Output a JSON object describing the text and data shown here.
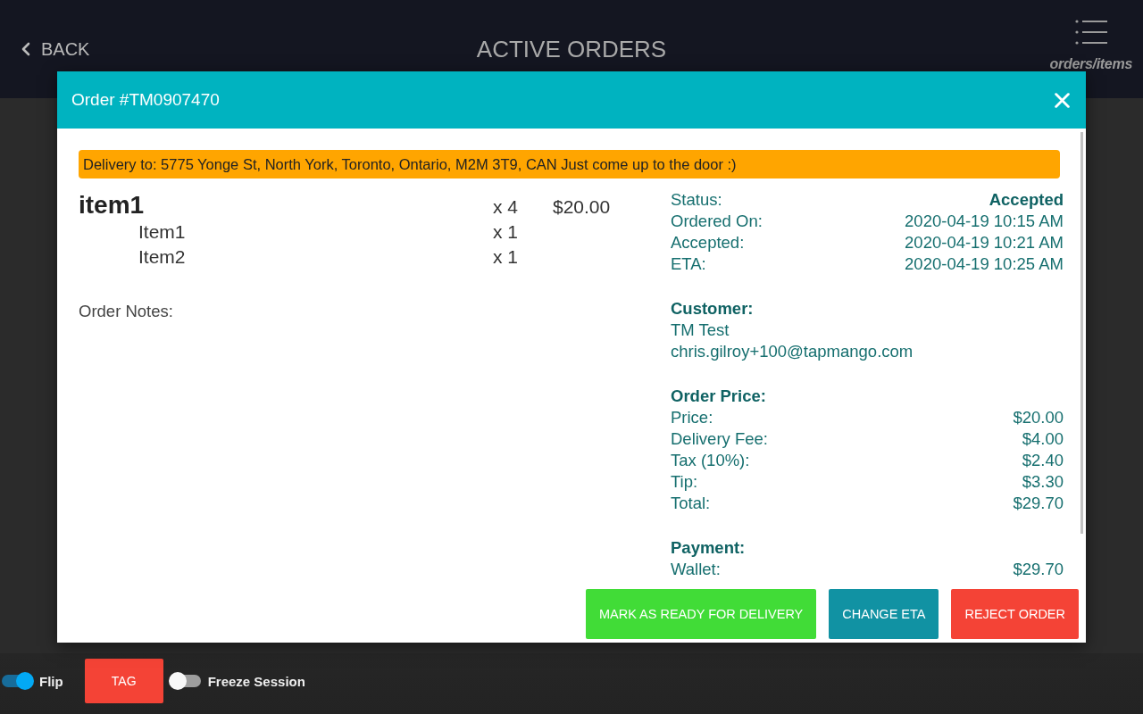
{
  "top_bar": {
    "back_label": "BACK",
    "title": "ACTIVE ORDERS",
    "menu_label": "orders/items"
  },
  "modal": {
    "title": "Order #TM0907470",
    "delivery_banner": "Delivery to: 5775 Yonge St, North York, Toronto, Ontario, M2M 3T9, CAN Just come up to the door :)",
    "items": [
      {
        "name": "item1",
        "quantity": "x 4",
        "price": "$20.00",
        "children": [
          {
            "name": "Item1",
            "quantity": "x 1"
          },
          {
            "name": "Item2",
            "quantity": "x 1"
          }
        ]
      }
    ],
    "notes_label": "Order Notes:",
    "info_sections": [
      {
        "rows": [
          {
            "label": "Status:",
            "value": "Accepted",
            "bold": true
          },
          {
            "label": "Ordered On:",
            "value": "2020-04-19 10:15 AM",
            "bold": false
          },
          {
            "label": "Accepted:",
            "value": "2020-04-19 10:21 AM",
            "bold": false
          },
          {
            "label": "ETA:",
            "value": "2020-04-19 10:25 AM",
            "bold": false
          }
        ]
      },
      {
        "heading": "Customer:",
        "lines": [
          "TM Test",
          "chris.gilroy+100@tapmango.com"
        ]
      },
      {
        "heading": "Order Price:",
        "rows": [
          {
            "label": "Price:",
            "value": "$20.00",
            "bold": false
          },
          {
            "label": "Delivery Fee:",
            "value": "$4.00",
            "bold": false
          },
          {
            "label": "Tax (10%):",
            "value": "$2.40",
            "bold": false
          },
          {
            "label": "Tip:",
            "value": "$3.30",
            "bold": false
          },
          {
            "label": "Total:",
            "value": "$29.70",
            "bold": false
          }
        ]
      },
      {
        "heading": "Payment:",
        "rows": [
          {
            "label": "Wallet:",
            "value": "$29.70",
            "bold": false
          }
        ]
      }
    ],
    "buttons": [
      {
        "label": "MARK AS READY FOR DELIVERY",
        "kind": "success"
      },
      {
        "label": "CHANGE ETA",
        "kind": "info"
      },
      {
        "label": "REJECT ORDER",
        "kind": "danger"
      }
    ]
  },
  "footer": [
    {
      "kind": "toggle",
      "label": "Flip",
      "on": true
    },
    {
      "kind": "button",
      "label": "TAG"
    },
    {
      "kind": "toggle",
      "label": "Freeze Session",
      "on": false
    }
  ]
}
